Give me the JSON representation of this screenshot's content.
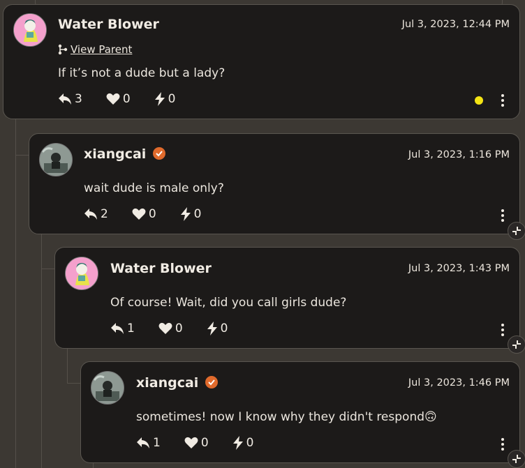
{
  "comments": [
    {
      "author": "Water Blower",
      "timestamp": "Jul 3, 2023, 12:44 PM",
      "view_parent": "View Parent",
      "text": "If it’s not a dude but a lady?",
      "replies": "3",
      "likes": "0",
      "boosts": "0",
      "avatar_icon": "anime-avatar-icon"
    },
    {
      "author": "xiangcai",
      "timestamp": "Jul 3, 2023, 1:16 PM",
      "text": "wait dude is male only?",
      "replies": "2",
      "likes": "0",
      "boosts": "0",
      "avatar_icon": "photo-avatar-icon"
    },
    {
      "author": "Water Blower",
      "timestamp": "Jul 3, 2023, 1:43 PM",
      "text": "Of course! Wait, did you call girls dude?",
      "replies": "1",
      "likes": "0",
      "boosts": "0",
      "avatar_icon": "anime-avatar-icon"
    },
    {
      "author": "xiangcai",
      "timestamp": "Jul 3, 2023, 1:46 PM",
      "text": "sometimes! now I know why they didn't respond",
      "emoji": "🙃",
      "replies": "1",
      "likes": "0",
      "boosts": "0",
      "avatar_icon": "photo-avatar-icon"
    }
  ],
  "colors": {
    "background": "#3c3833",
    "card": "#1c1a19",
    "verified_badge": "#e06a2c",
    "status_dot": "#f4e414"
  }
}
